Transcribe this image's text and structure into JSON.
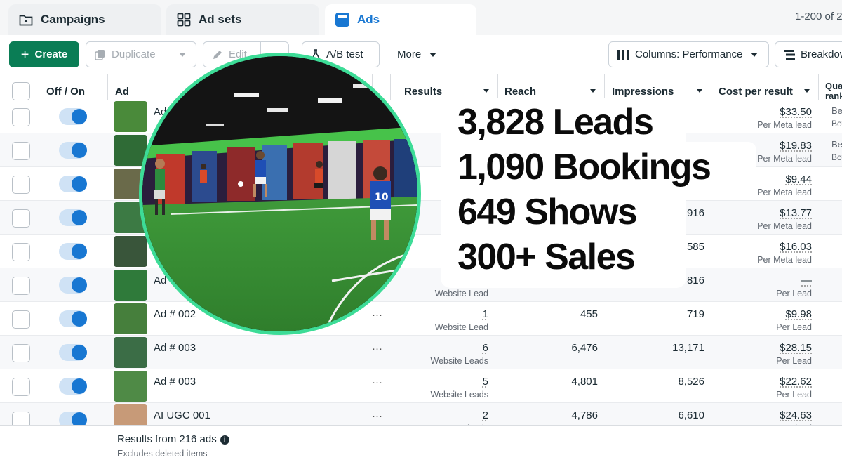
{
  "tabs": [
    {
      "label": "Campaigns",
      "icon": "folder-icon"
    },
    {
      "label": "Ad sets",
      "icon": "grid-icon"
    },
    {
      "label": "Ads",
      "icon": "ad-icon"
    }
  ],
  "pager_text": "1-200 of 2",
  "toolbar": {
    "create": "Create",
    "duplicate": "Duplicate",
    "edit": "Edit",
    "ab_test": "A/B test",
    "more": "More",
    "columns": "Columns: Performance",
    "breakdown": "Breakdow"
  },
  "columns": {
    "off_on": "Off / On",
    "ad": "Ad",
    "results": "Results",
    "reach": "Reach",
    "impressions": "Impressions",
    "cost_per_result": "Cost per result",
    "quality": "Qua rank"
  },
  "rows": [
    {
      "name": "Ad",
      "results": "",
      "results_label": "",
      "reach": "",
      "impressions": "",
      "cost": "$33.50",
      "cost_label": "Per Meta lead",
      "quality": "Be",
      "quality2": "Bott"
    },
    {
      "name": "",
      "results": "",
      "results_label": "",
      "reach": "",
      "impressions": "",
      "cost": "$19.83",
      "cost_label": "Per Meta lead",
      "quality": "Be",
      "quality2": "Bott"
    },
    {
      "name": "",
      "results": "",
      "results_label": "",
      "reach": "",
      "impressions": "",
      "cost": "$9.44",
      "cost_label": "Per Meta lead",
      "quality": "",
      "quality2": ""
    },
    {
      "name": "",
      "results": "",
      "results_label": "",
      "reach": "",
      "impressions": ",916",
      "cost": "$13.77",
      "cost_label": "Per Meta lead",
      "quality": "",
      "quality2": ""
    },
    {
      "name": "",
      "results": "",
      "results_label": "",
      "reach": "",
      "impressions": "585",
      "cost": "$16.03",
      "cost_label": "Per Meta lead",
      "quality": "",
      "quality2": ""
    },
    {
      "name": "Ad",
      "results": "",
      "results_label": "Website Lead",
      "reach": "",
      "impressions": "816",
      "cost": "—",
      "cost_label": "Per Lead",
      "quality": "",
      "quality2": ""
    },
    {
      "name": "Ad # 002",
      "results": "1",
      "results_label": "Website Lead",
      "reach": "455",
      "impressions": "719",
      "cost": "$9.98",
      "cost_label": "Per Lead",
      "quality": "",
      "quality2": ""
    },
    {
      "name": "Ad # 003",
      "results": "6",
      "results_label": "Website Leads",
      "reach": "6,476",
      "impressions": "13,171",
      "cost": "$28.15",
      "cost_label": "Per Lead",
      "quality": "",
      "quality2": ""
    },
    {
      "name": "Ad # 003",
      "results": "5",
      "results_label": "Website Leads",
      "reach": "4,801",
      "impressions": "8,526",
      "cost": "$22.62",
      "cost_label": "Per Lead",
      "quality": "",
      "quality2": ""
    },
    {
      "name": "AI UGC 001",
      "results": "2",
      "results_label": "Meta leads",
      "reach": "4,786",
      "impressions": "6,610",
      "cost": "$24.63",
      "cost_label": "Per Meta lead",
      "quality": "",
      "quality2": ""
    }
  ],
  "footer": {
    "title": "Results from 216 ads",
    "subtitle": "Excludes deleted items"
  },
  "overlay_stats": [
    "3,828 Leads",
    "1,090 Bookings",
    "649 Shows",
    "300+ Sales"
  ],
  "colors": {
    "accent_blue": "#1877d2",
    "create_green": "#0a7d55",
    "photo_ring": "#3ddc97"
  }
}
